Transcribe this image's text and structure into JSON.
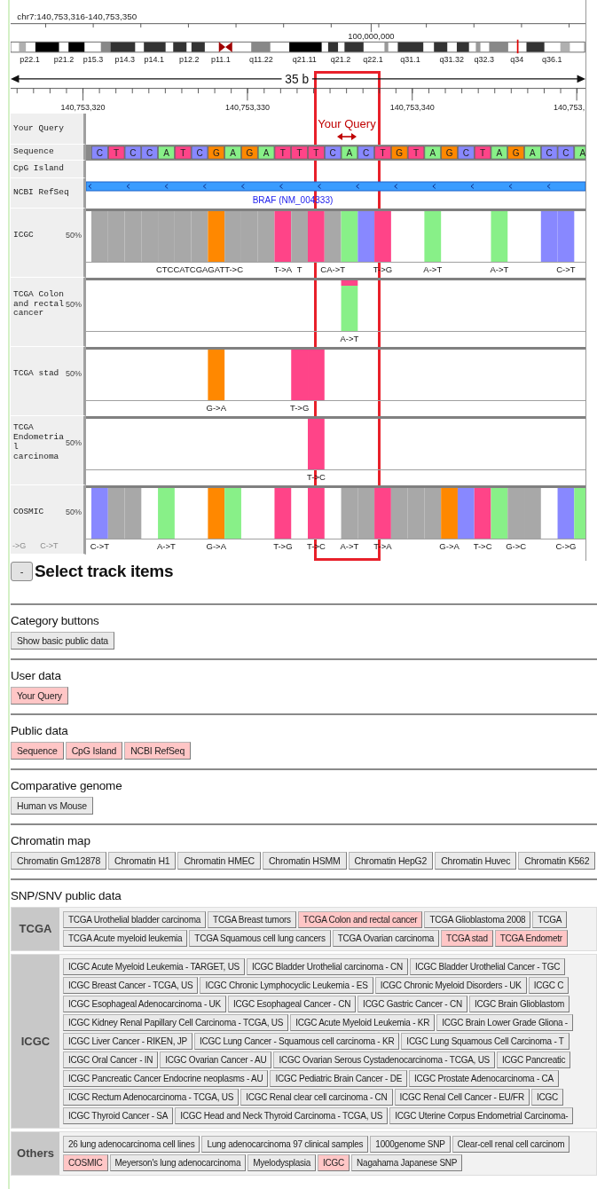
{
  "genome_view": {
    "coordinate": "chr7:140,753,316-140,753,350",
    "ideogram": {
      "position_label": "100,000,000",
      "bands": [
        "p22.1",
        "p21.2",
        "p15.3",
        "p14.3",
        "p14.1",
        "p12.2",
        "p11.1",
        "q11.22",
        "q21.11",
        "q21.2",
        "q22.1",
        "q31.1",
        "q31.32",
        "q32.3",
        "q34",
        "q36.1"
      ]
    },
    "scale": "35 b",
    "ruler_labels": [
      "140,753,320",
      "140,753,330",
      "140,753,340",
      "140,753,"
    ],
    "tracks": [
      {
        "kind": "query",
        "label": "Your Query",
        "marker_label": "Your Query"
      },
      {
        "kind": "sequence",
        "label": "Sequence",
        "bases": [
          {
            "base": "C",
            "color": "#8888ff"
          },
          {
            "base": "T",
            "color": "#ff4488"
          },
          {
            "base": "C",
            "color": "#8888ff"
          },
          {
            "base": "C",
            "color": "#8888ff"
          },
          {
            "base": "A",
            "color": "#88f088"
          },
          {
            "base": "T",
            "color": "#ff4488"
          },
          {
            "base": "C",
            "color": "#8888ff"
          },
          {
            "base": "G",
            "color": "#ff8800"
          },
          {
            "base": "A",
            "color": "#88f088"
          },
          {
            "base": "G",
            "color": "#ff8800"
          },
          {
            "base": "A",
            "color": "#88f088"
          },
          {
            "base": "T",
            "color": "#ff4488"
          },
          {
            "base": "T",
            "color": "#ff4488"
          },
          {
            "base": "T",
            "color": "#ff4488"
          },
          {
            "base": "C",
            "color": "#8888ff"
          },
          {
            "base": "A",
            "color": "#88f088"
          },
          {
            "base": "C",
            "color": "#8888ff"
          },
          {
            "base": "T",
            "color": "#ff4488"
          },
          {
            "base": "G",
            "color": "#ff8800"
          },
          {
            "base": "T",
            "color": "#ff4488"
          },
          {
            "base": "A",
            "color": "#88f088"
          },
          {
            "base": "G",
            "color": "#ff8800"
          },
          {
            "base": "C",
            "color": "#8888ff"
          },
          {
            "base": "T",
            "color": "#ff4488"
          },
          {
            "base": "A",
            "color": "#88f088"
          },
          {
            "base": "G",
            "color": "#ff8800"
          },
          {
            "base": "A",
            "color": "#88f088"
          },
          {
            "base": "C",
            "color": "#8888ff"
          },
          {
            "base": "C",
            "color": "#8888ff"
          },
          {
            "base": "A",
            "color": "#88f088"
          }
        ]
      },
      {
        "kind": "plain",
        "label": "CpG Island"
      },
      {
        "kind": "gene",
        "label": "NCBI RefSeq",
        "gene": "BRAF (NM_004333)"
      },
      {
        "kind": "mutation",
        "label": "ICGC",
        "tick": "50%",
        "columns": [
          {
            "kind": "empty"
          },
          {
            "kind": "bar",
            "color": "#a8a8a8"
          },
          {
            "kind": "bar",
            "color": "#a8a8a8"
          },
          {
            "kind": "bar",
            "color": "#a8a8a8"
          },
          {
            "kind": "bar",
            "color": "#a8a8a8"
          },
          {
            "kind": "bar",
            "color": "#a8a8a8"
          },
          {
            "kind": "bar",
            "color": "#a8a8a8"
          },
          {
            "kind": "bar",
            "color": "#a8a8a8",
            "label": "CTCCATCGAGATT->C"
          },
          {
            "kind": "bar",
            "color": "#ff8800"
          },
          {
            "kind": "bar",
            "color": "#a8a8a8"
          },
          {
            "kind": "bar",
            "color": "#a8a8a8"
          },
          {
            "kind": "bar",
            "color": "#a8a8a8"
          },
          {
            "kind": "bar",
            "color": "#ff4488",
            "label": "T->A"
          },
          {
            "kind": "bar",
            "color": "#a8a8a8",
            "label": "T"
          },
          {
            "kind": "bar",
            "color": "#ff4488"
          },
          {
            "kind": "bar",
            "color": "#a8a8a8",
            "label": "CA->T"
          },
          {
            "kind": "bar",
            "color": "#88f088"
          },
          {
            "kind": "bar",
            "color": "#8888ff"
          },
          {
            "kind": "bar",
            "color": "#ff4488",
            "label": "T->G"
          },
          {
            "kind": "empty"
          },
          {
            "kind": "empty"
          },
          {
            "kind": "bar",
            "color": "#88f088",
            "label": "A->T"
          },
          {
            "kind": "empty"
          },
          {
            "kind": "empty"
          },
          {
            "kind": "empty"
          },
          {
            "kind": "bar",
            "color": "#88f088",
            "label": "A->T"
          },
          {
            "kind": "empty"
          },
          {
            "kind": "empty"
          },
          {
            "kind": "bar",
            "color": "#8888ff"
          },
          {
            "kind": "bar",
            "color": "#8888ff",
            "label": "C->T"
          },
          {
            "kind": "empty"
          }
        ]
      },
      {
        "kind": "mutation",
        "label": "TCGA Colon and rectal cancer",
        "tick": "50%",
        "columns": [
          {
            "kind": "empty"
          },
          {
            "kind": "empty"
          },
          {
            "kind": "empty"
          },
          {
            "kind": "empty"
          },
          {
            "kind": "empty"
          },
          {
            "kind": "empty"
          },
          {
            "kind": "empty"
          },
          {
            "kind": "empty"
          },
          {
            "kind": "empty"
          },
          {
            "kind": "empty"
          },
          {
            "kind": "empty"
          },
          {
            "kind": "empty"
          },
          {
            "kind": "empty"
          },
          {
            "kind": "empty"
          },
          {
            "kind": "empty"
          },
          {
            "kind": "empty"
          },
          {
            "kind": "stacked_bar",
            "parts": [
              {
                "kind": "cap",
                "color": "#ff4488"
              },
              {
                "kind": "body",
                "color": "#88f088"
              }
            ],
            "label": "A->T"
          }
        ]
      },
      {
        "kind": "mutation",
        "label": "TCGA stad",
        "tick": "50%",
        "columns": [
          {
            "kind": "empty"
          },
          {
            "kind": "empty"
          },
          {
            "kind": "empty"
          },
          {
            "kind": "empty"
          },
          {
            "kind": "empty"
          },
          {
            "kind": "empty"
          },
          {
            "kind": "empty"
          },
          {
            "kind": "empty"
          },
          {
            "kind": "bar",
            "color": "#ff8800",
            "label": "G->A"
          },
          {
            "kind": "empty"
          },
          {
            "kind": "empty"
          },
          {
            "kind": "empty"
          },
          {
            "kind": "empty"
          },
          {
            "kind": "bar",
            "color": "#ff4488",
            "label": "T->G"
          },
          {
            "kind": "bar",
            "color": "#ff4488"
          }
        ]
      },
      {
        "kind": "mutation",
        "label": "TCGA Endometrial carcinoma",
        "tick": "50%",
        "columns": [
          {
            "kind": "empty"
          },
          {
            "kind": "empty"
          },
          {
            "kind": "empty"
          },
          {
            "kind": "empty"
          },
          {
            "kind": "empty"
          },
          {
            "kind": "empty"
          },
          {
            "kind": "empty"
          },
          {
            "kind": "empty"
          },
          {
            "kind": "empty"
          },
          {
            "kind": "empty"
          },
          {
            "kind": "empty"
          },
          {
            "kind": "empty"
          },
          {
            "kind": "empty"
          },
          {
            "kind": "empty"
          },
          {
            "kind": "bar",
            "color": "#ff4488",
            "label": "T->C"
          }
        ]
      },
      {
        "kind": "mutation",
        "label": "COSMIC",
        "tick": "50%",
        "ghost_labels": [
          "->G",
          "C->T"
        ],
        "columns": [
          {
            "kind": "empty"
          },
          {
            "kind": "bar",
            "color": "#8888ff",
            "label": "C->T"
          },
          {
            "kind": "bar",
            "color": "#a8a8a8"
          },
          {
            "kind": "bar",
            "color": "#a8a8a8"
          },
          {
            "kind": "empty"
          },
          {
            "kind": "bar",
            "color": "#88f088",
            "label": "A->T"
          },
          {
            "kind": "empty"
          },
          {
            "kind": "empty"
          },
          {
            "kind": "bar",
            "color": "#ff8800",
            "label": "G->A"
          },
          {
            "kind": "bar",
            "color": "#88f088"
          },
          {
            "kind": "empty"
          },
          {
            "kind": "empty"
          },
          {
            "kind": "bar",
            "color": "#ff4488",
            "label": "T->G"
          },
          {
            "kind": "empty"
          },
          {
            "kind": "bar",
            "color": "#ff4488",
            "label": "T->C"
          },
          {
            "kind": "empty"
          },
          {
            "kind": "bar",
            "color": "#a8a8a8",
            "label": "A->T"
          },
          {
            "kind": "bar",
            "color": "#a8a8a8"
          },
          {
            "kind": "bar",
            "color": "#ff4488",
            "label": "T->A"
          },
          {
            "kind": "bar",
            "color": "#a8a8a8"
          },
          {
            "kind": "bar",
            "color": "#a8a8a8"
          },
          {
            "kind": "bar",
            "color": "#a8a8a8"
          },
          {
            "kind": "bar",
            "color": "#ff8800",
            "label": "G->A"
          },
          {
            "kind": "bar",
            "color": "#8888ff"
          },
          {
            "kind": "bar",
            "color": "#ff4488",
            "label": "T->C"
          },
          {
            "kind": "bar",
            "color": "#88f088"
          },
          {
            "kind": "bar",
            "color": "#a8a8a8",
            "label": "G->C"
          },
          {
            "kind": "bar",
            "color": "#a8a8a8"
          },
          {
            "kind": "empty"
          },
          {
            "kind": "bar",
            "color": "#8888ff",
            "label": "C->G"
          },
          {
            "kind": "bar",
            "color": "#88f088"
          }
        ]
      }
    ]
  },
  "track_panel": {
    "toggle": "-",
    "title": "Select track items",
    "sections": [
      {
        "title": "Category buttons",
        "buttons": [
          {
            "label": "Show basic public data",
            "selected": false
          }
        ]
      },
      {
        "title": "User data",
        "buttons": [
          {
            "label": "Your Query",
            "selected": true
          }
        ]
      },
      {
        "title": "Public data",
        "buttons": [
          {
            "label": "Sequence",
            "selected": true
          },
          {
            "label": "CpG Island",
            "selected": true
          },
          {
            "label": "NCBI RefSeq",
            "selected": true
          }
        ]
      },
      {
        "title": "Comparative genome",
        "buttons": [
          {
            "label": "Human vs Mouse",
            "selected": false
          }
        ]
      },
      {
        "title": "Chromatin map",
        "buttons": [
          {
            "label": "Chromatin Gm12878",
            "selected": false
          },
          {
            "label": "Chromatin H1",
            "selected": false
          },
          {
            "label": "Chromatin HMEC",
            "selected": false
          },
          {
            "label": "Chromatin HSMM",
            "selected": false
          },
          {
            "label": "Chromatin HepG2",
            "selected": false
          },
          {
            "label": "Chromatin Huvec",
            "selected": false
          },
          {
            "label": "Chromatin K562",
            "selected": false
          }
        ]
      }
    ],
    "snp": {
      "title": "SNP/SNV public data",
      "groups": [
        {
          "name": "TCGA",
          "lines": [
            {
              "buttons": [
                {
                  "label": "TCGA Urothelial bladder carcinoma",
                  "selected": false
                },
                {
                  "label": "TCGA Breast tumors",
                  "selected": false
                },
                {
                  "label": "TCGA Colon and rectal cancer",
                  "selected": true
                },
                {
                  "label": "TCGA Glioblastoma 2008",
                  "selected": false
                },
                {
                  "label": "TCGA",
                  "selected": false
                }
              ]
            },
            {
              "buttons": [
                {
                  "label": "TCGA Acute myeloid leukemia",
                  "selected": false
                },
                {
                  "label": "TCGA Squamous cell lung cancers",
                  "selected": false
                },
                {
                  "label": "TCGA Ovarian carcinoma",
                  "selected": false
                },
                {
                  "label": "TCGA stad",
                  "selected": true
                },
                {
                  "label": "TCGA Endometr",
                  "selected": true
                }
              ]
            }
          ]
        },
        {
          "name": "ICGC",
          "lines": [
            {
              "buttons": [
                {
                  "label": "ICGC Acute Myeloid Leukemia - TARGET, US",
                  "selected": false
                },
                {
                  "label": "ICGC Bladder Urothelial carcinoma - CN",
                  "selected": false
                },
                {
                  "label": "ICGC Bladder Urothelial Cancer - TGC",
                  "selected": false
                }
              ]
            },
            {
              "buttons": [
                {
                  "label": "ICGC Breast Cancer - TCGA, US",
                  "selected": false
                },
                {
                  "label": "ICGC Chronic Lymphocyclic Leukemia - ES",
                  "selected": false
                },
                {
                  "label": "ICGC Chronic Myeloid Disorders - UK",
                  "selected": false
                },
                {
                  "label": "ICGC C",
                  "selected": false
                }
              ]
            },
            {
              "buttons": [
                {
                  "label": "ICGC Esophageal Adenocarcinoma - UK",
                  "selected": false
                },
                {
                  "label": "ICGC Esophageal Cancer - CN",
                  "selected": false
                },
                {
                  "label": "ICGC Gastric Cancer - CN",
                  "selected": false
                },
                {
                  "label": "ICGC Brain Glioblastom",
                  "selected": false
                }
              ]
            },
            {
              "buttons": [
                {
                  "label": "ICGC Kidney Renal Papillary Cell Carcinoma - TCGA, US",
                  "selected": false
                },
                {
                  "label": "ICGC Acute Myeloid Leukemia - KR",
                  "selected": false
                },
                {
                  "label": "ICGC Brain Lower Grade Gliona -",
                  "selected": false
                }
              ]
            },
            {
              "buttons": [
                {
                  "label": "ICGC Liver Cancer - RIKEN, JP",
                  "selected": false
                },
                {
                  "label": "ICGC Lung Cancer - Squamous cell carcinoma - KR",
                  "selected": false
                },
                {
                  "label": "ICGC Lung Squamous Cell Carcinoma - T",
                  "selected": false
                }
              ]
            },
            {
              "buttons": [
                {
                  "label": "ICGC Oral Cancer - IN",
                  "selected": false
                },
                {
                  "label": "ICGC Ovarian Cancer - AU",
                  "selected": false
                },
                {
                  "label": "ICGC Ovarian Serous Cystadenocarcinoma - TCGA, US",
                  "selected": false
                },
                {
                  "label": "ICGC Pancreatic",
                  "selected": false
                }
              ]
            },
            {
              "buttons": [
                {
                  "label": "ICGC Pancreatic Cancer Endocrine neoplasms - AU",
                  "selected": false
                },
                {
                  "label": "ICGC Pediatric Brain Cancer - DE",
                  "selected": false
                },
                {
                  "label": "ICGC Prostate Adenocarcinoma - CA",
                  "selected": false
                }
              ]
            },
            {
              "buttons": [
                {
                  "label": "ICGC Rectum Adenocarcinoma - TCGA, US",
                  "selected": false
                },
                {
                  "label": "ICGC Renal clear cell carcinoma - CN",
                  "selected": false
                },
                {
                  "label": "ICGC Renal Cell Cancer - EU/FR",
                  "selected": false
                },
                {
                  "label": "ICGC",
                  "selected": false
                }
              ]
            },
            {
              "buttons": [
                {
                  "label": "ICGC Thyroid Cancer - SA",
                  "selected": false
                },
                {
                  "label": "ICGC Head and Neck Thyroid Carcinoma - TCGA, US",
                  "selected": false
                },
                {
                  "label": "ICGC Uterine Corpus Endometrial Carcinoma-",
                  "selected": false
                }
              ]
            }
          ]
        },
        {
          "name": "Others",
          "lines": [
            {
              "buttons": [
                {
                  "label": "26 lung adenocarcinoma cell lines",
                  "selected": false
                },
                {
                  "label": "Lung adenocarcinoma 97 clinical samples",
                  "selected": false
                },
                {
                  "label": "1000genome SNP",
                  "selected": false
                },
                {
                  "label": "Clear-cell renal cell carcinom",
                  "selected": false
                }
              ]
            },
            {
              "buttons": [
                {
                  "label": "COSMIC",
                  "selected": true
                },
                {
                  "label": "Meyerson's lung adenocarcinoma",
                  "selected": false
                },
                {
                  "label": "Myelodysplasia",
                  "selected": false
                },
                {
                  "label": "ICGC",
                  "selected": true
                },
                {
                  "label": "Nagahama Japanese SNP",
                  "selected": false
                }
              ]
            }
          ]
        }
      ]
    }
  }
}
